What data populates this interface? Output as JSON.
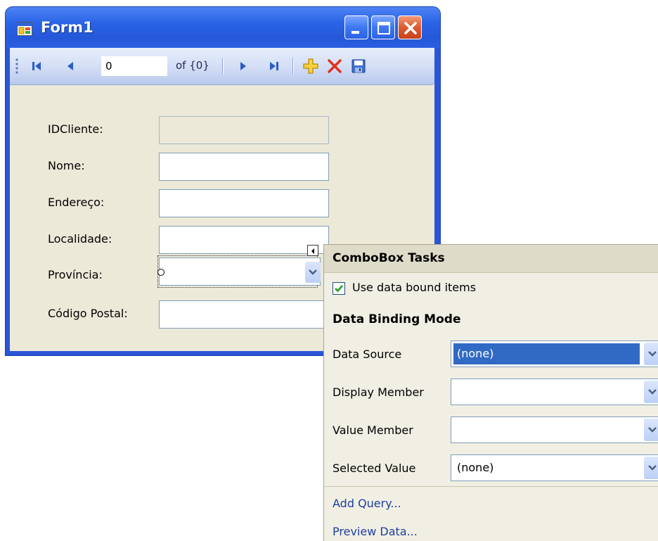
{
  "window": {
    "title": "Form1",
    "icon": "form-icon",
    "buttons": [
      "minimize-icon",
      "maximize-icon",
      "close-icon"
    ]
  },
  "navigator": {
    "position_value": "0",
    "count_label": "of {0}",
    "buttons": [
      "move-first-icon",
      "move-previous-icon",
      "move-next-icon",
      "move-last-icon",
      "add-new-icon",
      "delete-icon",
      "save-icon"
    ]
  },
  "form": {
    "fields": [
      {
        "label": "IDCliente:",
        "enabled": false
      },
      {
        "label": "Nome:",
        "enabled": true
      },
      {
        "label": "Endereço:",
        "enabled": true
      },
      {
        "label": "Localidade:",
        "enabled": true
      },
      {
        "label": "Província:",
        "type": "combobox",
        "enabled": true
      },
      {
        "label": "Código Postal:",
        "enabled": true
      }
    ]
  },
  "tasks_panel": {
    "title": "ComboBox Tasks",
    "use_data_bound_label": "Use data bound items",
    "use_data_bound_checked": true,
    "section_title": "Data Binding Mode",
    "properties": [
      {
        "label": "Data Source",
        "value": "(none)",
        "selected": true
      },
      {
        "label": "Display Member",
        "value": ""
      },
      {
        "label": "Value Member",
        "value": ""
      },
      {
        "label": "Selected Value",
        "value": "(none)"
      }
    ],
    "links": [
      "Add Query...",
      "Preview Data..."
    ]
  },
  "colors": {
    "titlebar": "#2a63e6",
    "client_bg": "#ece9d8",
    "selection": "#316ac5",
    "link": "#1e3f9c"
  }
}
